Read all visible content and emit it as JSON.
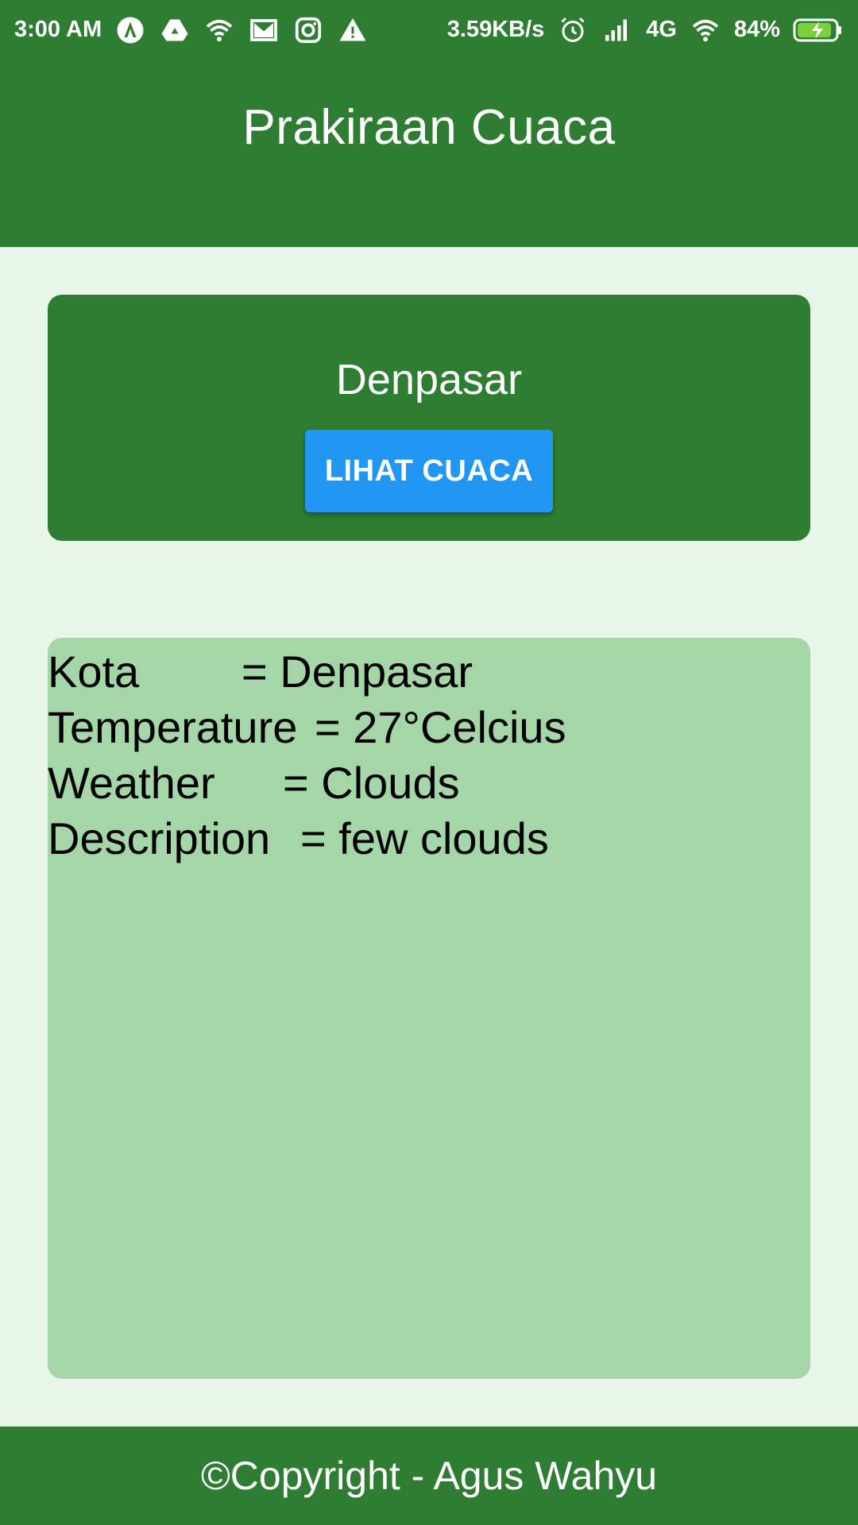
{
  "status_bar": {
    "time": "3:00 AM",
    "left_icons": [
      "app-icon",
      "drive-icon",
      "wifi-link-icon",
      "gmail-icon",
      "instagram-icon",
      "warning-icon"
    ],
    "net_speed": "3.59KB/s",
    "network": "4G",
    "battery": "84%",
    "battery_color": "#7cd13b"
  },
  "header": {
    "title": "Prakiraan Cuaca"
  },
  "city_card": {
    "city": "Denpasar",
    "button_label": "LIHAT CUACA"
  },
  "weather": {
    "rows": [
      {
        "label": "Kota",
        "value": "Denpasar"
      },
      {
        "label": "Temperature",
        "value": "27°Celcius"
      },
      {
        "label": "Weather",
        "value": "Clouds"
      },
      {
        "label": "Description",
        "value": "few clouds"
      }
    ]
  },
  "footer": {
    "copyright": "©Copyright - Agus Wahyu"
  },
  "colors": {
    "primary": "#2e7d32",
    "background": "#e8f5e9",
    "result_bg": "#a5d6a7",
    "button": "#2196f3"
  }
}
